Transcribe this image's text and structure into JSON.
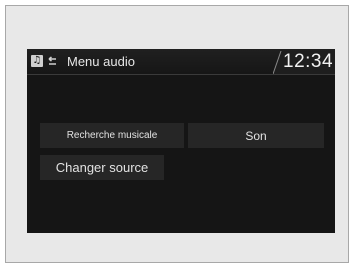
{
  "header": {
    "music_icon": "music-note-icon",
    "back_icon": "back-arrow-icon",
    "title": "Menu audio",
    "clock": "12:34"
  },
  "menu": {
    "items": [
      {
        "label": "Recherche musicale"
      },
      {
        "label": "Son"
      },
      {
        "label": "Changer source"
      }
    ]
  },
  "colors": {
    "screen_background": "#151515",
    "button_background": "#262626",
    "text": "#e6e6e6",
    "frame_background": "#e8e8e8"
  }
}
